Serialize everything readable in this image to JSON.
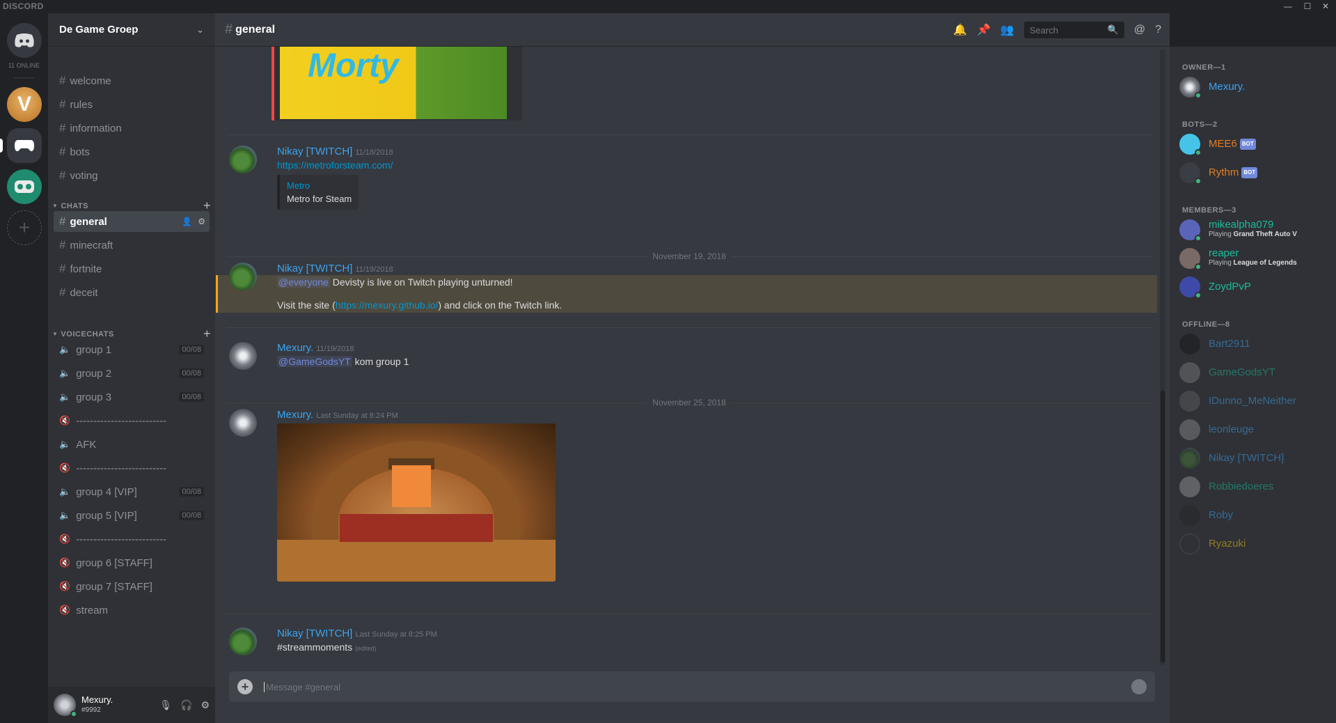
{
  "titlebar": {
    "brand": "DISCORD",
    "minimize": "—",
    "maximize": "☐",
    "close": "✕"
  },
  "guilds": {
    "online": "11 ONLINE",
    "add": "+"
  },
  "server": {
    "name": "De Game Groep"
  },
  "text_channels": [
    "welcome",
    "rules",
    "information",
    "bots",
    "voting"
  ],
  "categories": {
    "chats": "CHATS",
    "voice": "VOICECHATS"
  },
  "chat_channels": [
    "general",
    "minecraft",
    "fortnite",
    "deceit"
  ],
  "voice_channels": [
    {
      "name": "group 1",
      "count": "00/08"
    },
    {
      "name": "group 2",
      "count": "00/08"
    },
    {
      "name": "group 3",
      "count": "00/08"
    },
    {
      "name": "--------------------------",
      "count": null
    },
    {
      "name": "AFK",
      "count": null
    },
    {
      "name": "--------------------------",
      "count": null
    },
    {
      "name": "group 4 [VIP]",
      "count": "00/08"
    },
    {
      "name": "group 5 [VIP]",
      "count": "00/08"
    },
    {
      "name": "--------------------------",
      "count": null
    },
    {
      "name": "group 6 [STAFF]",
      "count": null
    },
    {
      "name": "group 7 [STAFF]",
      "count": null
    },
    {
      "name": "stream",
      "count": null
    }
  ],
  "user": {
    "name": "Mexury.",
    "tag": "#9992"
  },
  "chat": {
    "channel": "general",
    "search_placeholder": "Search",
    "composer_placeholder": "Message #general"
  },
  "messages": [
    {
      "author": "Nikay [TWITCH]",
      "time": "11/18/2018",
      "link": "https://metroforsteam.com/",
      "embed_provider": "Metro",
      "embed_desc": "Metro for Steam"
    },
    {
      "date": "November 19, 2018"
    },
    {
      "author": "Nikay [TWITCH]",
      "time": "11/19/2018",
      "mention": "@everyone",
      "line1": " Devisty is live on Twitch playing unturned!",
      "line2a": "Visit the site (",
      "line2link": "https://mexury.github.io/",
      "line2b": ") and click on the Twitch link."
    },
    {
      "author": "Mexury.",
      "time": "11/19/2018",
      "mention": "@GameGodsYT",
      "text": " kom group 1"
    },
    {
      "date": "November 25, 2018"
    },
    {
      "author": "Mexury.",
      "time": "Last Sunday at 8:24 PM"
    },
    {
      "author": "Nikay [TWITCH]",
      "time": "Last Sunday at 8:25 PM",
      "text": "#streammoments",
      "edited": "(edited)"
    }
  ],
  "members": {
    "owner_header": "OWNER—1",
    "owner": [
      {
        "name": "Mexury.",
        "color": "#3ca4f0"
      }
    ],
    "bots_header": "BOTS—2",
    "bots": [
      {
        "name": "MEE6",
        "color": "#e67e22"
      },
      {
        "name": "Rythm",
        "color": "#e67e22"
      }
    ],
    "bot_tag": "BOT",
    "members_header": "MEMBERS—3",
    "members": [
      {
        "name": "mikealpha079",
        "color": "#1abc9c",
        "playing": "Playing",
        "game": "Grand Theft Auto V"
      },
      {
        "name": "reaper",
        "color": "#1abc9c",
        "playing": "Playing",
        "game": "League of Legends"
      },
      {
        "name": "ZoydPvP",
        "color": "#1abc9c"
      }
    ],
    "offline_header": "OFFLINE—8",
    "offline": [
      {
        "name": "Bart2911",
        "color": "#3ca4f0"
      },
      {
        "name": "GameGodsYT",
        "color": "#1abc9c"
      },
      {
        "name": "IDunno_MeNeither",
        "color": "#3ca4f0"
      },
      {
        "name": "leonleuge",
        "color": "#3ca4f0"
      },
      {
        "name": "Nikay [TWITCH]",
        "color": "#3ca4f0"
      },
      {
        "name": "Robbiedoeres",
        "color": "#1abc9c"
      },
      {
        "name": "Roby",
        "color": "#3ca4f0"
      },
      {
        "name": "Ryazuki",
        "color": "#f1c40f"
      }
    ]
  },
  "colors": {
    "accent": "#7289da",
    "link": "#0096cf",
    "online": "#43b581",
    "mention_bg": "#4f4a3e"
  }
}
